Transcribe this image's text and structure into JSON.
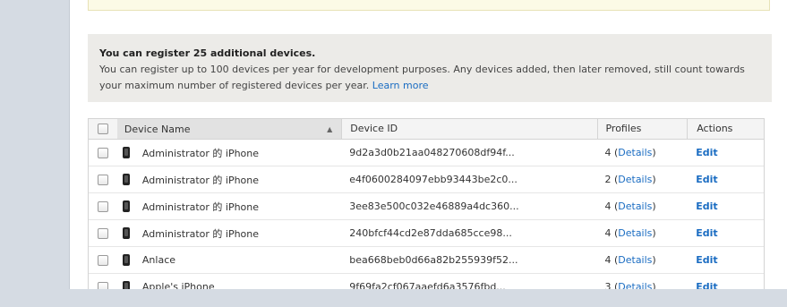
{
  "info": {
    "title": "You can register 25 additional devices.",
    "text": "You can register up to 100 devices per year for development purposes. Any devices added, then later removed, still count towards your maximum number of registered devices per year.",
    "learn_more": "Learn more"
  },
  "table": {
    "headers": {
      "name": "Device Name",
      "id": "Device ID",
      "profiles": "Profiles",
      "actions": "Actions"
    },
    "rows": [
      {
        "name": "Administrator 的 iPhone",
        "id": "9d2a3d0b21aa048270608df94f...",
        "count": "4",
        "details": "Details",
        "edit": "Edit"
      },
      {
        "name": "Administrator 的 iPhone",
        "id": "e4f0600284097ebb93443be2c0...",
        "count": "2",
        "details": "Details",
        "edit": "Edit"
      },
      {
        "name": "Administrator 的 iPhone",
        "id": "3ee83e500c032e46889a4dc360...",
        "count": "4",
        "details": "Details",
        "edit": "Edit"
      },
      {
        "name": "Administrator 的 iPhone",
        "id": "240bfcf44cd2e87dda685cce98...",
        "count": "4",
        "details": "Details",
        "edit": "Edit"
      },
      {
        "name": "Anlace",
        "id": "bea668beb0d66a82b255939f52...",
        "count": "4",
        "details": "Details",
        "edit": "Edit"
      },
      {
        "name": "Apple's iPhone",
        "id": "9f69fa2cf067aaefd6a3576fbd...",
        "count": "3",
        "details": "Details",
        "edit": "Edit"
      }
    ]
  }
}
